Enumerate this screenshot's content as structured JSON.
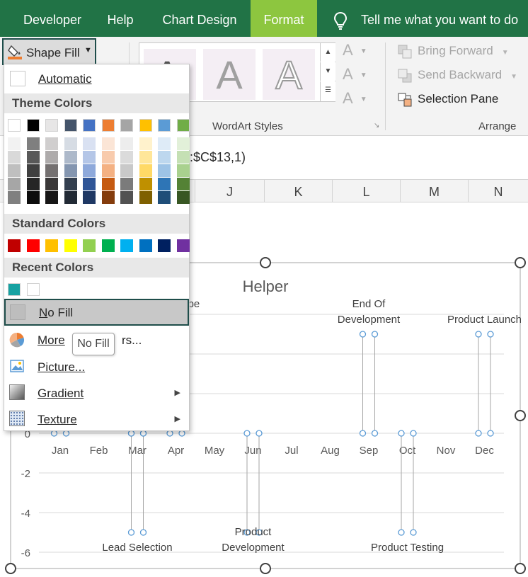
{
  "ribbon_tabs": [
    "Developer",
    "Help",
    "Chart Design",
    "Format"
  ],
  "active_tab": "Format",
  "tell_me": "Tell me what you want to do",
  "shape_fill": {
    "label": "Shape Fill",
    "caret": "⌄"
  },
  "wordart": {
    "letters": [
      "A",
      "A"
    ],
    "label": "WordArt Styles",
    "text_effect_letters": [
      "A",
      "A",
      "A"
    ]
  },
  "arrange": {
    "bring_forward": "Bring Forward",
    "send_backward": "Send Backward",
    "selection_pane": "Selection Pane",
    "label": "Arrange"
  },
  "formula": {
    "text": ":$C$13,1)"
  },
  "columns": [
    "J",
    "K",
    "L",
    "M",
    "N"
  ],
  "menu": {
    "automatic": "Automatic",
    "theme_colors_header": "Theme Colors",
    "theme_top": [
      "#ffffff",
      "#000000",
      "#e7e6e6",
      "#44546a",
      "#4472c4",
      "#ed7d31",
      "#a5a5a5",
      "#ffc000",
      "#5b9bd5",
      "#70ad47"
    ],
    "theme_shades": [
      [
        "#f2f2f2",
        "#d9d9d9",
        "#bfbfbf",
        "#a6a6a6",
        "#808080"
      ],
      [
        "#7f7f7f",
        "#595959",
        "#404040",
        "#262626",
        "#0d0d0d"
      ],
      [
        "#d0cece",
        "#aeabab",
        "#757171",
        "#3a3838",
        "#171616"
      ],
      [
        "#d6dce4",
        "#adb9ca",
        "#8496b0",
        "#333f4f",
        "#222a35"
      ],
      [
        "#d9e1f2",
        "#b4c6e7",
        "#8ea9db",
        "#2f5597",
        "#1f3864"
      ],
      [
        "#fbe5d6",
        "#f8cbad",
        "#f4b183",
        "#c55a11",
        "#843c0c"
      ],
      [
        "#ededed",
        "#dbdbdb",
        "#c9c9c9",
        "#7b7b7b",
        "#525252"
      ],
      [
        "#fff2cc",
        "#ffe699",
        "#ffd966",
        "#bf9000",
        "#7f6000"
      ],
      [
        "#deebf7",
        "#bdd7ee",
        "#9dc3e6",
        "#2e75b6",
        "#1f4e79"
      ],
      [
        "#e2f0d9",
        "#c5e0b4",
        "#a9d18e",
        "#548235",
        "#385723"
      ]
    ],
    "standard_colors_header": "Standard Colors",
    "standard_colors": [
      "#c00000",
      "#ff0000",
      "#ffc000",
      "#ffff00",
      "#92d050",
      "#00b050",
      "#00b0f0",
      "#0070c0",
      "#002060",
      "#7030a0"
    ],
    "recent_colors_header": "Recent Colors",
    "recent_colors": [
      "#17a2a2",
      "#ffffff"
    ],
    "no_fill": "No Fill",
    "more_colors": "More Fill Colors...",
    "more_colors_visible": "More",
    "more_colors_tail": "rs...",
    "picture": "Picture...",
    "gradient": "Gradient",
    "texture": "Texture"
  },
  "tooltip": "No Fill",
  "chart_data": {
    "type": "scatter",
    "title": "Helper",
    "categories": [
      "Jan",
      "Feb",
      "Mar",
      "Apr",
      "May",
      "Jun",
      "Jul",
      "Aug",
      "Sep",
      "Oct",
      "Nov",
      "Dec"
    ],
    "y_ticks": [
      0,
      -2,
      -4,
      -6
    ],
    "ylim": [
      -6,
      6
    ],
    "milestones": [
      {
        "month": "Mar",
        "value": -5,
        "label_lines": [
          "Lead Selection"
        ]
      },
      {
        "month": "Mar",
        "value": 5,
        "label_lines": [
          "Scope",
          "Review"
        ],
        "label_visible": [
          "cope",
          "w"
        ]
      },
      {
        "month": "Jun",
        "value": -5,
        "label_lines": [
          "Product",
          "Development"
        ]
      },
      {
        "month": "Sep",
        "value": 5,
        "label_lines": [
          "End Of",
          "Development"
        ]
      },
      {
        "month": "Oct",
        "value": -5,
        "label_lines": [
          "Product Testing"
        ]
      },
      {
        "month": "Dec",
        "value": 5,
        "label_lines": [
          "Product Launch"
        ]
      }
    ],
    "baseline_points": [
      "Jan",
      "Apr"
    ],
    "marker_color": "#5b9bd5",
    "line_color": "#a6a6a6"
  }
}
